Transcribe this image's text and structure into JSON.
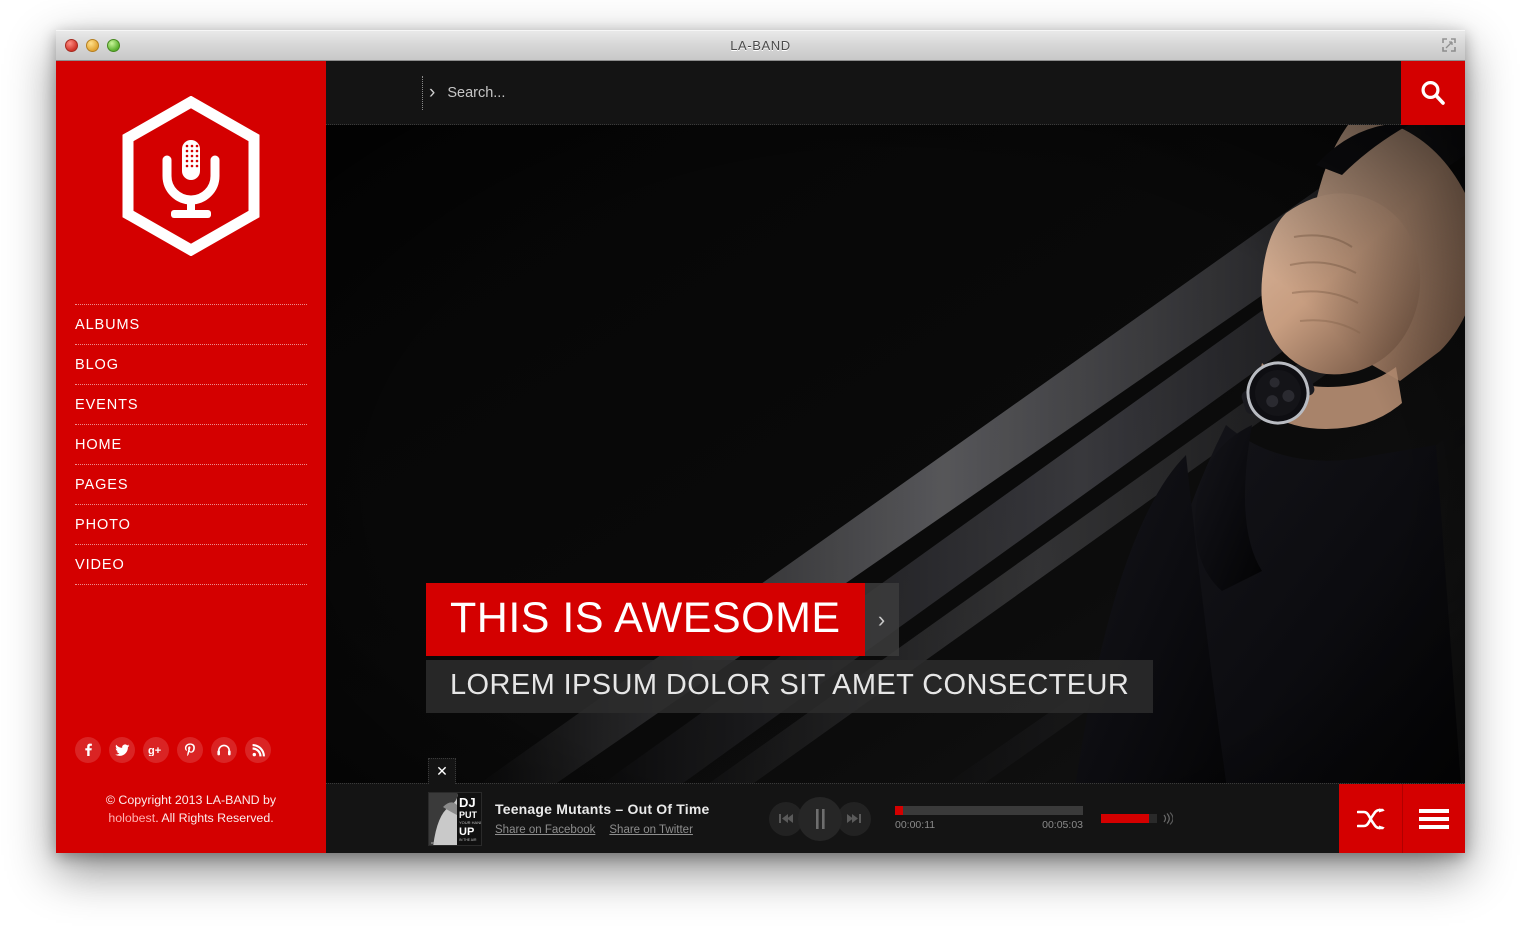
{
  "window": {
    "title": "LA-BAND",
    "traffic_lights": [
      "close",
      "minimize",
      "maximize"
    ],
    "resize_icon": "fullscreen-icon"
  },
  "colors": {
    "brand_red": "#d40000",
    "panel_dark": "#141414",
    "caption_gray": "#2d2d2d"
  },
  "sidebar": {
    "logo": {
      "icon": "hexagon-microphone-logo",
      "alt": "LA-BAND microphone hexagon logo"
    },
    "nav": [
      {
        "label": "ALBUMS"
      },
      {
        "label": "BLOG"
      },
      {
        "label": "EVENTS"
      },
      {
        "label": "HOME"
      },
      {
        "label": "PAGES"
      },
      {
        "label": "PHOTO"
      },
      {
        "label": "VIDEO"
      }
    ],
    "social": [
      {
        "name": "facebook-icon",
        "glyph": "f"
      },
      {
        "name": "twitter-icon",
        "glyph": "t"
      },
      {
        "name": "google-plus-icon",
        "glyph": "g+"
      },
      {
        "name": "pinterest-icon",
        "glyph": "P"
      },
      {
        "name": "headphones-icon",
        "glyph": "h"
      },
      {
        "name": "rss-icon",
        "glyph": "r"
      }
    ],
    "copyright": {
      "line1": "© Copyright 2013 LA-BAND by",
      "brand": "holobest",
      "line2": ". All Rights Reserved."
    }
  },
  "search": {
    "placeholder": "Search...",
    "value": "",
    "marker": "›",
    "button_icon": "search-icon"
  },
  "hero": {
    "photo_alt": "Man in black clothing with hand covering face wearing a wristwatch, dark streaked background",
    "slide_title": "THIS IS AWESOME",
    "slide_subtitle": "LOREM IPSUM DOLOR SIT AMET CONSECTEUR",
    "next_arrow": "›"
  },
  "player": {
    "close_label": "✕",
    "album_art_alt": "DJ PUT YOUR HANDS UP album cover",
    "track_title": "Teenage Mutants – Out Of Time",
    "share": [
      {
        "label": "Share on Facebook"
      },
      {
        "label": "Share on Twitter"
      }
    ],
    "controls": {
      "prev": "prev-track-button",
      "play_pause": "pause-button",
      "next": "next-track-button"
    },
    "current_time": "00:00:11",
    "total_time": "00:05:03",
    "progress_percent": 4,
    "volume_percent": 86,
    "right_buttons": [
      {
        "name": "shuffle-button",
        "icon": "shuffle-icon"
      },
      {
        "name": "playlist-menu-button",
        "icon": "hamburger-icon"
      }
    ]
  }
}
